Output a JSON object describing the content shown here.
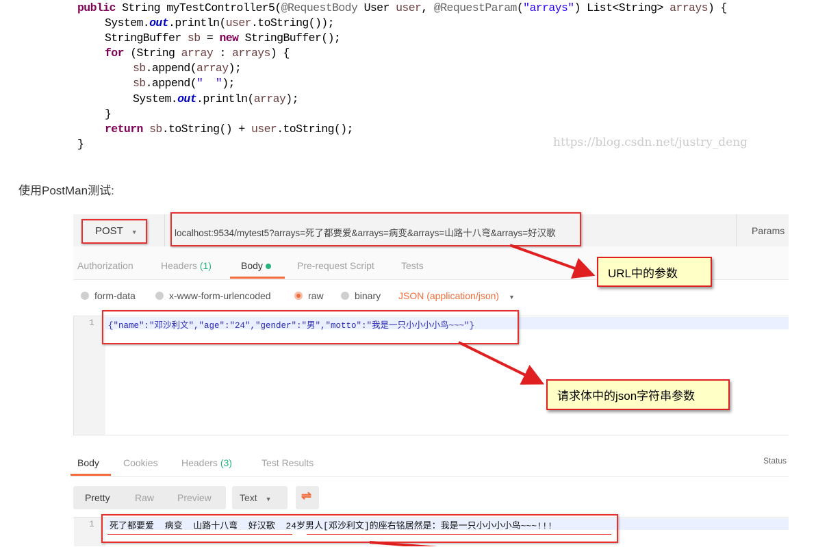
{
  "code": {
    "lines": [
      [
        "public",
        " String myTestController5(",
        "@RequestBody",
        " User ",
        "user",
        ", ",
        "@RequestParam",
        "(",
        "\"arrays\"",
        ") List<String> ",
        "arrays",
        ") {"
      ],
      [
        "System.",
        "out",
        ".println(",
        "user",
        ".toString());"
      ],
      [
        "StringBuffer ",
        "sb",
        " = ",
        "new",
        " StringBuffer();"
      ],
      [
        "for",
        " (String ",
        "array",
        " : ",
        "arrays",
        ") {"
      ],
      [
        "sb",
        ".append(",
        "array",
        ");"
      ],
      [
        "sb",
        ".append(",
        "\"  \"",
        ");"
      ],
      [
        "System.",
        "out",
        ".println(",
        "array",
        ");"
      ],
      [
        "}"
      ],
      [
        "return",
        " ",
        "sb",
        ".toString() + ",
        "user",
        ".toString();"
      ],
      [
        "}"
      ]
    ],
    "watermark": "https://blog.csdn.net/justry_deng"
  },
  "intro_text": "使用PostMan测试:",
  "postman": {
    "method": "POST",
    "url": "localhost:9534/mytest5?arrays=死了都要爱&arrays=病变&arrays=山路十八弯&arrays=好汉歌",
    "params_label": "Params",
    "request_tabs": [
      {
        "label": "Authorization",
        "count": ""
      },
      {
        "label": "Headers",
        "count": "(1)"
      },
      {
        "label": "Body",
        "count": ""
      },
      {
        "label": "Pre-request Script",
        "count": ""
      },
      {
        "label": "Tests",
        "count": ""
      }
    ],
    "body_types": [
      "form-data",
      "x-www-form-urlencoded",
      "raw",
      "binary"
    ],
    "content_type": "JSON (application/json)",
    "request_body": "{\"name\":\"邓沙利文\",\"age\":\"24\",\"gender\":\"男\",\"motto\":\"我是一只小小小小鸟~~~\"}",
    "line_number": "1",
    "response_tabs": [
      {
        "label": "Body",
        "count": ""
      },
      {
        "label": "Cookies",
        "count": ""
      },
      {
        "label": "Headers",
        "count": "(3)"
      },
      {
        "label": "Test Results",
        "count": ""
      }
    ],
    "status_label": "Status",
    "view_modes": [
      "Pretty",
      "Raw",
      "Preview"
    ],
    "format": "Text",
    "response_part1": "死了都要爱  病变  山路十八弯  好汉歌  ",
    "response_part2": "24岁男人[邓沙利文]的座右铭居然是：我是一只小小小小鸟~~~!!!"
  },
  "callouts": {
    "url": "URL中的参数",
    "body": "请求体中的json字符串参数"
  },
  "colors": {
    "accent": "#f26b3a",
    "green": "#26b47f",
    "annotation_red": "#e53030",
    "callout_bg": "#ffffc6"
  }
}
